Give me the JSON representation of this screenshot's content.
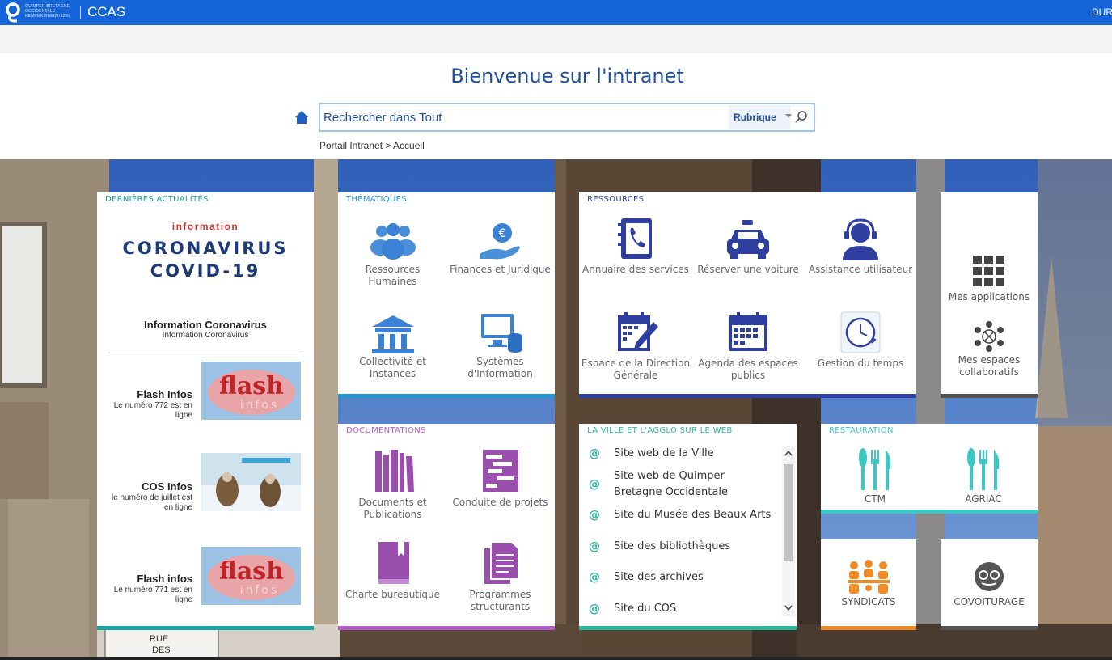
{
  "header": {
    "logo_text_lines": [
      "QUIMPER BRETAGNE",
      "OCCIDENTALE",
      "KEMPER BREIZH IZEL"
    ],
    "app_name": "CCAS",
    "user_short": "DUR",
    "color": "#1565d8"
  },
  "welcome_title": "Bienvenue sur l'intranet",
  "search": {
    "placeholder": "Rechercher dans Tout",
    "scope_label": "Rubrique"
  },
  "breadcrumb": "Portail Intranet > Accueil",
  "news": {
    "title": "DERNIÈRES ACTUALITÉS",
    "accent": "#1aa3a3",
    "banner_top": "information",
    "banner_line1": "CORONAVIRUS",
    "banner_line2": "COVID-19",
    "feature_title": "Information Coronavirus",
    "feature_sub": "Information Coronavirus",
    "items": [
      {
        "title": "Flash Infos",
        "sub": "Le numéro 772 est en ligne",
        "thumb": "flash",
        "thumb_word1": "flash",
        "thumb_word2": "infos"
      },
      {
        "title": "COS Infos",
        "sub": "le numéro de juillet est en ligne",
        "thumb": "cos"
      },
      {
        "title": "Flash infos",
        "sub": "Le numéro 771 est en ligne",
        "thumb": "flash",
        "thumb_word1": "flash",
        "thumb_word2": "infos"
      }
    ]
  },
  "thematiques": {
    "title": "THÉMATIQUES",
    "accent": "#2196d3",
    "items": [
      {
        "label": "Ressources Humaines",
        "icon": "people-icon"
      },
      {
        "label": "Finances et Juridique",
        "icon": "euro-hand-icon"
      },
      {
        "label": "Collectivité et Instances",
        "icon": "building-icon"
      },
      {
        "label": "Systèmes d'Information",
        "icon": "computer-icon"
      }
    ]
  },
  "ressources": {
    "title": "RESSOURCES",
    "accent": "#2e3fa8",
    "items": [
      {
        "label": "Annuaire des services",
        "icon": "phonebook-icon"
      },
      {
        "label": "Réserver une voiture",
        "icon": "car-icon"
      },
      {
        "label": "Assistance utilisateur",
        "icon": "headset-icon"
      },
      {
        "label": "Espace de la Direction Générale",
        "icon": "calendar-pen-icon"
      },
      {
        "label": "Agenda des espaces publics",
        "icon": "calendar-icon"
      },
      {
        "label": "Gestion du temps",
        "icon": "clock-icon"
      }
    ]
  },
  "apps": {
    "items": [
      {
        "label": "Mes applications",
        "icon": "grid-icon"
      },
      {
        "label": "Mes espaces collaboratifs",
        "icon": "network-icon"
      }
    ]
  },
  "documentations": {
    "title": "DOCUMENTATIONS",
    "accent": "#b35ec8",
    "items": [
      {
        "label": "Documents et Publications",
        "icon": "books-icon"
      },
      {
        "label": "Conduite de projets",
        "icon": "gantt-icon"
      },
      {
        "label": "Charte bureautique",
        "icon": "book-icon"
      },
      {
        "label": "Programmes structurants",
        "icon": "documents-icon"
      }
    ]
  },
  "web": {
    "title": "LA VILLE ET L'AGGLO SUR LE WEB",
    "accent": "#2bb89a",
    "links": [
      "Site web de la Ville",
      "Site web de Quimper Bretagne Occidentale",
      "Site du Musée des Beaux Arts",
      "Site des bibliothèques",
      "Site des archives",
      "Site du COS"
    ]
  },
  "restauration": {
    "title": "RESTAURATION",
    "accent": "#3cc7c2",
    "items": [
      {
        "label": "CTM",
        "icon": "cutlery-icon"
      },
      {
        "label": "AGRIAC",
        "icon": "cutlery-icon"
      }
    ]
  },
  "syndicats": {
    "label": "SYNDICATS",
    "icon": "meeting-icon",
    "accent": "#f08a24"
  },
  "covoiturage": {
    "label": "COVOITURAGE",
    "icon": "carpool-icon",
    "accent": "#555555"
  },
  "background_sign_lines": [
    "RUE",
    "DES"
  ]
}
